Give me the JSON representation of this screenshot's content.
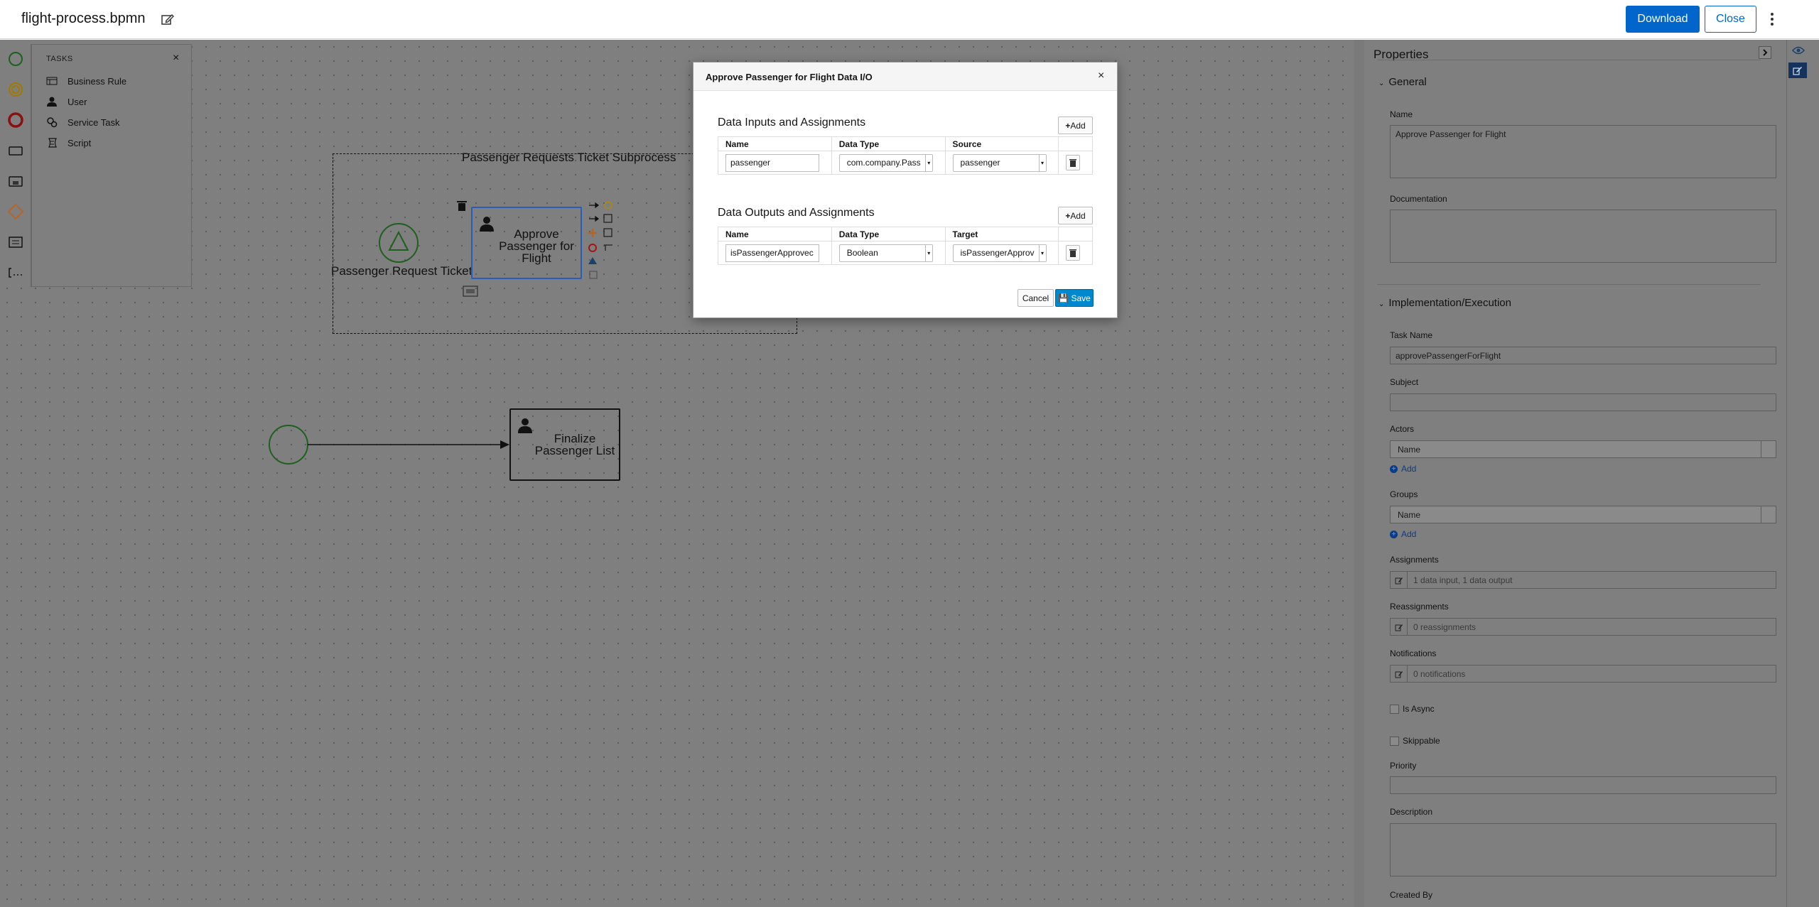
{
  "header": {
    "file_name": "flight-process.bpmn",
    "download_label": "Download",
    "close_label": "Close"
  },
  "palette": {
    "tasks_title": "TASKS",
    "close_glyph": "×",
    "items": [
      {
        "label": "Business Rule",
        "icon": "business-rule-icon"
      },
      {
        "label": "User",
        "icon": "user-icon"
      },
      {
        "label": "Service Task",
        "icon": "service-task-icon"
      },
      {
        "label": "Script",
        "icon": "script-icon"
      }
    ]
  },
  "diagram": {
    "subprocess_label": "Passenger Requests Ticket Subprocess",
    "start_event_label": "Passenger Request Ticket",
    "task1_label": "Approve Passenger for Flight",
    "task2_label": "Finalize Passenger List"
  },
  "modal": {
    "title": "Approve Passenger for Flight Data I/O",
    "close_glyph": "×",
    "inputs_title": "Data Inputs and Assignments",
    "outputs_title": "Data Outputs and Assignments",
    "add_label": "Add",
    "inputs_headers": [
      "Name",
      "Data Type",
      "Source"
    ],
    "outputs_headers": [
      "Name",
      "Data Type",
      "Target"
    ],
    "input_row": {
      "name": "passenger",
      "data_type": "com.company.Pass",
      "source": "passenger"
    },
    "output_row": {
      "name": "isPassengerApprovec",
      "data_type": "Boolean",
      "target": "isPassengerApprov"
    },
    "cancel_label": "Cancel",
    "save_label": "Save"
  },
  "properties": {
    "title": "Properties",
    "general_section": "General",
    "name_label": "Name",
    "name_value": "Approve Passenger for Flight",
    "documentation_label": "Documentation",
    "documentation_value": "",
    "impl_section": "Implementation/Execution",
    "task_name_label": "Task Name",
    "task_name_value": "approvePassengerForFlight",
    "subject_label": "Subject",
    "subject_value": "",
    "actors_label": "Actors",
    "actors_column": "Name",
    "actors_add": "Add",
    "groups_label": "Groups",
    "groups_column": "Name",
    "groups_add": "Add",
    "assignments_label": "Assignments",
    "assignments_value": "1 data input, 1 data output",
    "reassignments_label": "Reassignments",
    "reassignments_value": "0 reassignments",
    "notifications_label": "Notifications",
    "notifications_value": "0 notifications",
    "is_async_label": "Is Async",
    "skippable_label": "Skippable",
    "priority_label": "Priority",
    "priority_value": "",
    "description_label": "Description",
    "description_value": "",
    "created_by_label": "Created By"
  },
  "colors": {
    "primary": "#0066cc",
    "save_button": "#0088ce",
    "overlay_gray": "#7f7f7f",
    "selected_task_border": "#2a5dba"
  }
}
